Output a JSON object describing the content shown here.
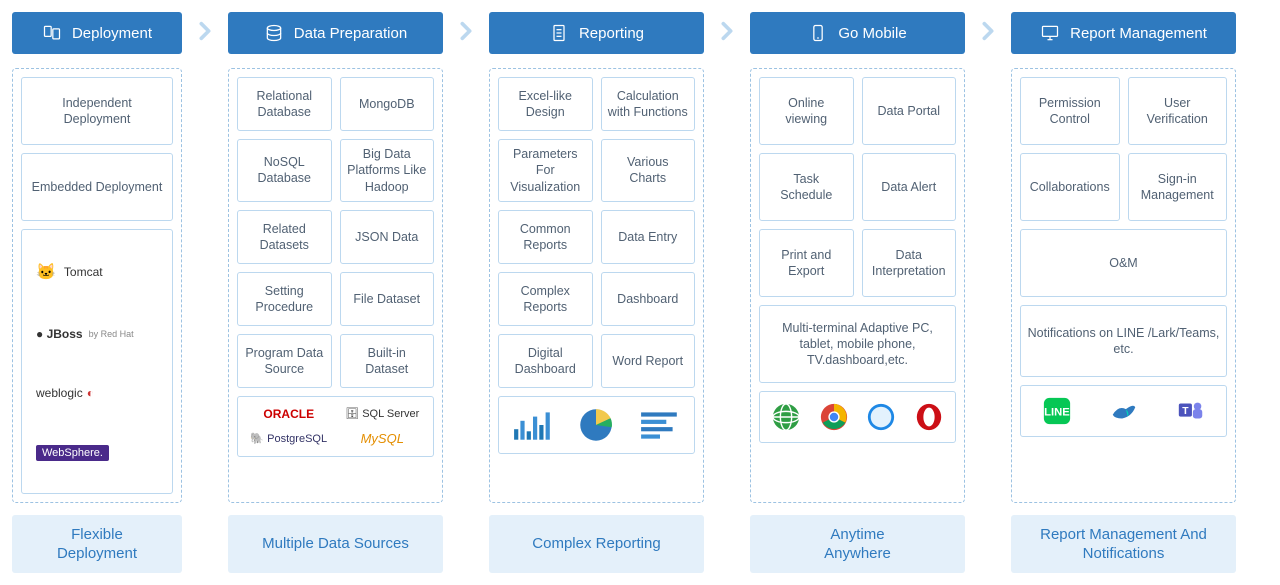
{
  "columns": [
    {
      "header": "Deployment",
      "footer": "Flexible\nDeployment",
      "items": [
        "Independent Deployment",
        "Embedded Deployment"
      ],
      "server_logos": [
        "Tomcat",
        "JBoss",
        "weblogic",
        "WebSphere."
      ]
    },
    {
      "header": "Data Preparation",
      "footer": "Multiple Data Sources",
      "items": [
        "Relational Database",
        "MongoDB",
        "NoSQL Database",
        "Big Data Platforms Like Hadoop",
        "Related Datasets",
        "JSON Data",
        "Setting Procedure",
        "File Dataset",
        "Program Data Source",
        "Built-in Dataset"
      ],
      "db_logos": [
        "ORACLE",
        "SQL Server",
        "PostgreSQL",
        "MySQL"
      ]
    },
    {
      "header": "Reporting",
      "footer": "Complex Reporting",
      "items": [
        "Excel-like Design",
        "Calculation with Functions",
        "Parameters For Visualization",
        "Various Charts",
        "Common Reports",
        "Data Entry",
        "Complex Reports",
        "Dashboard",
        "Digital Dashboard",
        "Word Report"
      ],
      "chart_icons": [
        "bar-chart",
        "pie-chart",
        "horizontal-bar"
      ]
    },
    {
      "header": "Go Mobile",
      "footer": "Anytime\nAnywhere",
      "items": [
        "Online viewing",
        "Data Portal",
        "Task Schedule",
        "Data Alert",
        "Print and Export",
        "Data Interpretation"
      ],
      "wide_item": "Multi-terminal Adaptive PC, tablet, mobile phone, TV.dashboard,etc.",
      "browser_icons": [
        "globe",
        "chrome",
        "safari",
        "opera"
      ]
    },
    {
      "header": "Report Management",
      "footer": "Report Management And Notifications",
      "items": [
        "Permission Control",
        "User Verification",
        "Collaborations",
        "Sign-in Management"
      ],
      "wide_items": [
        "O&M",
        "Notifications on LINE /Lark/Teams, etc."
      ],
      "notif_icons": [
        "line",
        "lark",
        "teams"
      ]
    }
  ]
}
